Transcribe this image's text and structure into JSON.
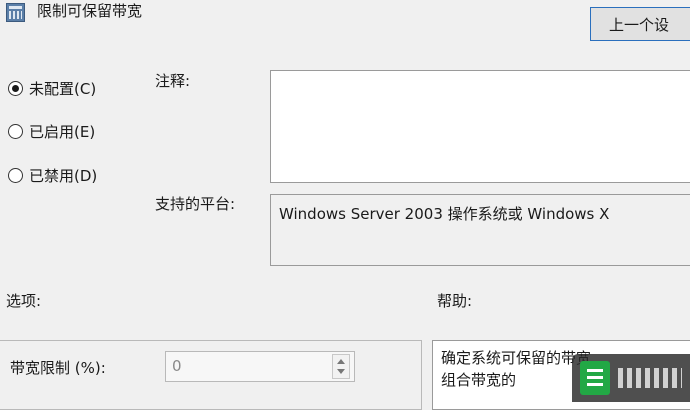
{
  "window": {
    "title": "限制可保留带宽",
    "icon": "policy-setting-icon"
  },
  "toolbar": {
    "prev_button_label": "上一个设"
  },
  "state": {
    "options": [
      {
        "label": "未配置(C)",
        "checked": true
      },
      {
        "label": "已启用(E)",
        "checked": false
      },
      {
        "label": "已禁用(D)",
        "checked": false
      }
    ]
  },
  "comment": {
    "label": "注释:",
    "value": ""
  },
  "platform": {
    "label": "支持的平台:",
    "value": "Windows Server 2003 操作系统或 Windows X"
  },
  "options_section": {
    "label": "选项:",
    "bandwidth_label": "带宽限制 (%):",
    "bandwidth_value": "0"
  },
  "help_section": {
    "label": "帮助:",
    "lines": [
      "确定系统可保留的带宽",
      "组合带宽的"
    ]
  },
  "colors": {
    "background": "#f0f0f0",
    "accent_border": "#2a6fbd"
  }
}
